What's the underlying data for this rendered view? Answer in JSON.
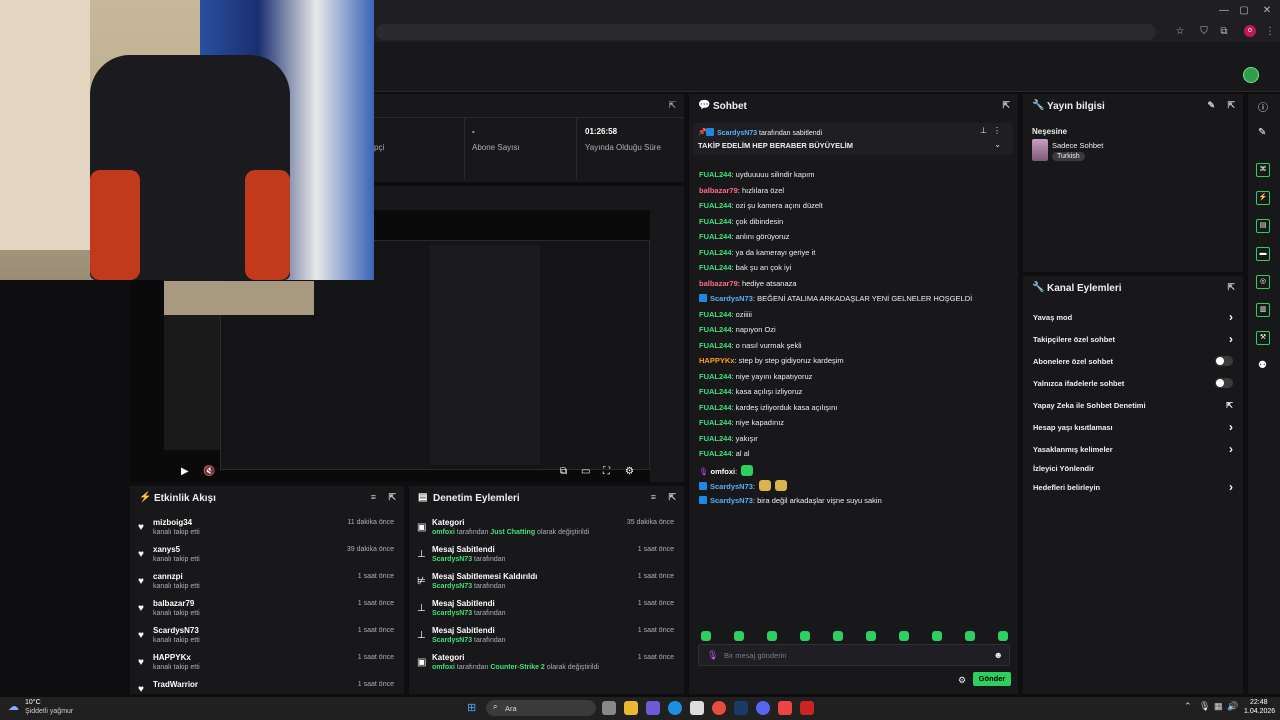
{
  "header": {
    "stats": [
      {
        "value": "",
        "label": "pçi"
      },
      {
        "value": "-",
        "label": "Abone Sayısı"
      },
      {
        "value": "01:26:58",
        "label": "Yayında Olduğu Süre"
      }
    ]
  },
  "chat": {
    "title": "Sohbet",
    "pinned_by": "ScardysN73",
    "pinned_by_suffix": "tarafından sabitlendi",
    "pinned_text": "TAKİP EDELİM HEP BERABER BÜYÜYELİM",
    "messages": [
      {
        "user": "FUAL244",
        "color": "#3ee07b",
        "text": ": uyduuuuu silindir kapım",
        "badge": false
      },
      {
        "user": "balbazar79",
        "color": "#ff6b8a",
        "text": ": hızlılara özel",
        "badge": false
      },
      {
        "user": "FUAL244",
        "color": "#3ee07b",
        "text": ": ozi şu kamera açını düzelt",
        "badge": false
      },
      {
        "user": "FUAL244",
        "color": "#3ee07b",
        "text": ": çok dibindesin",
        "badge": false
      },
      {
        "user": "FUAL244",
        "color": "#3ee07b",
        "text": ": anlını görüyoruz",
        "badge": false
      },
      {
        "user": "FUAL244",
        "color": "#3ee07b",
        "text": ": ya da kamerayı geriye it",
        "badge": false
      },
      {
        "user": "FUAL244",
        "color": "#3ee07b",
        "text": ": bak şu an çok iyi",
        "badge": false
      },
      {
        "user": "balbazar79",
        "color": "#ff6b8a",
        "text": ": hediye atsanaza",
        "badge": false
      },
      {
        "user": "ScardysN73",
        "color": "#53b3ff",
        "text": ": BEĞENİ ATALIMA ARKADAŞLAR YENİ GELNELER HOŞGELDİ",
        "badge": true
      },
      {
        "user": "FUAL244",
        "color": "#3ee07b",
        "text": ": oziiiii",
        "badge": false
      },
      {
        "user": "FUAL244",
        "color": "#3ee07b",
        "text": ": napıyon Ozi",
        "badge": false
      },
      {
        "user": "FUAL244",
        "color": "#3ee07b",
        "text": ": o nasıl vurmak şekli",
        "badge": false
      },
      {
        "user": "HAPPYKx",
        "color": "#ff9f1a",
        "text": ": step by step gidiyoruz kardeşim",
        "badge": false
      },
      {
        "user": "FUAL244",
        "color": "#3ee07b",
        "text": ": niye yayını kapatıyoruz",
        "badge": false
      },
      {
        "user": "FUAL244",
        "color": "#3ee07b",
        "text": ": kasa açılışı izliyoruz",
        "badge": false
      },
      {
        "user": "FUAL244",
        "color": "#3ee07b",
        "text": ": kardeş izliyorduk kasa açılışını",
        "badge": false
      },
      {
        "user": "FUAL244",
        "color": "#3ee07b",
        "text": ": niye kapadınız",
        "badge": false
      },
      {
        "user": "FUAL244",
        "color": "#3ee07b",
        "text": ": yakışır",
        "badge": false
      },
      {
        "user": "FUAL244",
        "color": "#3ee07b",
        "text": ": al al",
        "badge": false
      },
      {
        "user": "omfoxi",
        "color": "#ffffff",
        "text": ":",
        "badge": false
      },
      {
        "user": "ScardysN73",
        "color": "#53b3ff",
        "text": ":",
        "badge": true
      },
      {
        "user": "ScardysN73",
        "color": "#53b3ff",
        "text": ": bira değil arkadaşlar vişne suyu sakin",
        "badge": true
      }
    ],
    "input_placeholder": "Bir mesaj gönderin",
    "send_label": "Gönder"
  },
  "stream_info": {
    "title": "Yayın bilgisi",
    "streamer": "Neşesine",
    "category": "Sadece Sohbet",
    "tag": "Turkish"
  },
  "channel_actions": {
    "title": "Kanal Eylemleri",
    "items": [
      {
        "label": "Yavaş mod",
        "control": "chevron"
      },
      {
        "label": "Takipçilere özel sohbet",
        "control": "chevron"
      },
      {
        "label": "Abonelere özel sohbet",
        "control": "toggle"
      },
      {
        "label": "Yalnızca ifadelerle sohbet",
        "control": "toggle"
      },
      {
        "label": "Yapay Zeka ile Sohbet Denetimi",
        "control": "external"
      },
      {
        "label": "Hesap yaşı kısıtlaması",
        "control": "chevron"
      },
      {
        "label": "Yasaklanmış kelimeler",
        "control": "chevron"
      },
      {
        "label": "İzleyici Yönlendir",
        "control": "none"
      },
      {
        "label": "Hedefleri belirleyin",
        "control": "chevron"
      }
    ]
  },
  "activity_feed": {
    "title": "Etkinlik Akışı",
    "items": [
      {
        "name": "mizboig34",
        "sub": "kanalı takip etti",
        "time": "11 dakika önce"
      },
      {
        "name": "xanys5",
        "sub": "kanalı takip etti",
        "time": "39 dakika önce"
      },
      {
        "name": "cannzpi",
        "sub": "kanalı takip etti",
        "time": "1 saat önce"
      },
      {
        "name": "balbazar79",
        "sub": "kanalı takip etti",
        "time": "1 saat önce"
      },
      {
        "name": "ScardysN73",
        "sub": "kanalı takip etti",
        "time": "1 saat önce"
      },
      {
        "name": "HAPPYKx",
        "sub": "kanalı takip etti",
        "time": "1 saat önce"
      },
      {
        "name": "TradWarrior",
        "sub": "",
        "time": "1 saat önce"
      }
    ]
  },
  "mod_actions": {
    "title": "Denetim Eylemleri",
    "items": [
      {
        "icon": "📅",
        "title": "Kategori",
        "who": "omfoxi",
        "mid": " tarafından ",
        "what": "Just Chatting",
        "tail": " olarak değiştirildi",
        "time": "35 dakika önce"
      },
      {
        "icon": "📌",
        "title": "Mesaj Sabitlendi",
        "who": "ScardysN73",
        "mid": " tarafından",
        "what": "",
        "tail": "",
        "time": "1 saat önce"
      },
      {
        "icon": "📌",
        "title": "Mesaj Sabitlemesi Kaldırıldı",
        "who": "ScardysN73",
        "mid": " tarafından",
        "what": "",
        "tail": "",
        "time": "1 saat önce"
      },
      {
        "icon": "📌",
        "title": "Mesaj Sabitlendi",
        "who": "ScardysN73",
        "mid": " tarafından",
        "what": "",
        "tail": "",
        "time": "1 saat önce"
      },
      {
        "icon": "📌",
        "title": "Mesaj Sabitlendi",
        "who": "ScardysN73",
        "mid": " tarafından",
        "what": "",
        "tail": "",
        "time": "1 saat önce"
      },
      {
        "icon": "📅",
        "title": "Kategori",
        "who": "omfoxi",
        "mid": " tarafından ",
        "what": "Counter-Strike 2",
        "tail": " olarak değiştirildi",
        "time": "1 saat önce"
      }
    ]
  },
  "taskbar": {
    "weather_temp": "10°C",
    "weather_desc": "Şiddetli yağmur",
    "search_label": "Ara",
    "time": "22:48",
    "date": "1.04.2026"
  }
}
